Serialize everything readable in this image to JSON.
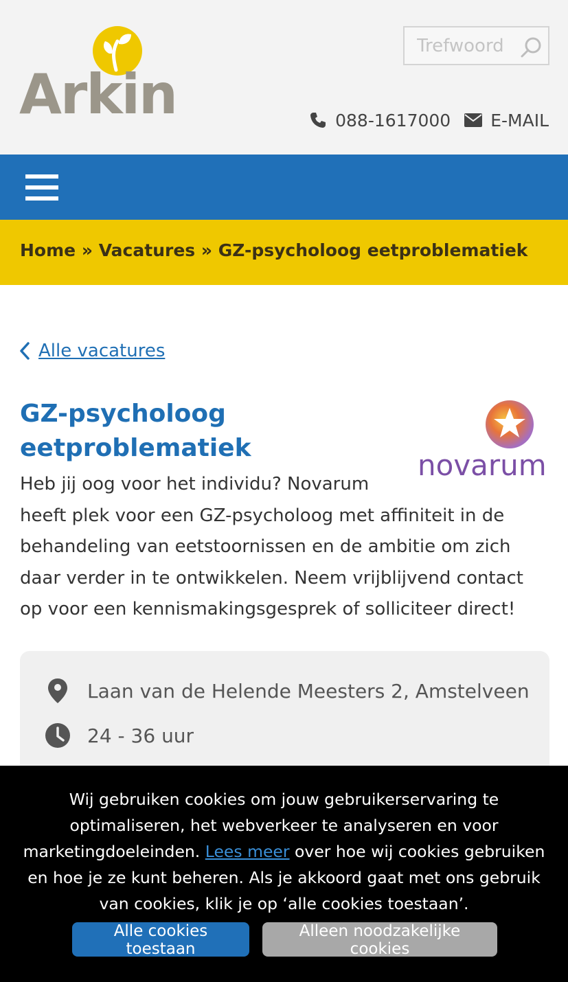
{
  "header": {
    "logo_text": "Arkin",
    "search": {
      "placeholder": "Trefwoord"
    },
    "phone": "088-1617000",
    "email_label": "E-MAIL"
  },
  "breadcrumb": {
    "items": [
      "Home",
      "Vacatures",
      "GZ-psycholoog eetproblematiek"
    ],
    "separator": "»"
  },
  "main": {
    "back_link": "Alle vacatures",
    "title": "GZ-psycholoog eetproblematiek",
    "org_logo": "novarum",
    "intro": "Heb jij oog voor het individu? Novarum heeft plek voor een GZ-psycholoog met affiniteit in de behandeling van eetstoornissen en de ambitie om zich daar verder in te ontwikkelen. Neem vrijblijvend contact op voor een kennismakingsgesprek of solliciteer direct!",
    "info": {
      "location": "Laan van de Helende Meesters 2, Amstelveen",
      "hours": "24 - 36 uur"
    }
  },
  "cookie_banner": {
    "text_before": "Wij gebruiken cookies om jouw gebruikerservaring te optimaliseren, het webverkeer te analyseren en voor marketingdoeleinden.",
    "link": "Lees meer",
    "text_after": "over hoe wij cookies gebruiken en hoe je ze kunt beheren. Als je akkoord gaat met ons gebruik van cookies, klik je op ‘alle cookies toestaan’.",
    "accept_all": "Alle cookies toestaan",
    "necessary_only": "Alleen noodzakelijke cookies"
  },
  "colors": {
    "brand_blue": "#2070b8",
    "brand_yellow": "#efc800",
    "logo_grey": "#9b968a",
    "link_blue": "#1f6fb4",
    "novarum_purple": "#7b4fa6"
  }
}
